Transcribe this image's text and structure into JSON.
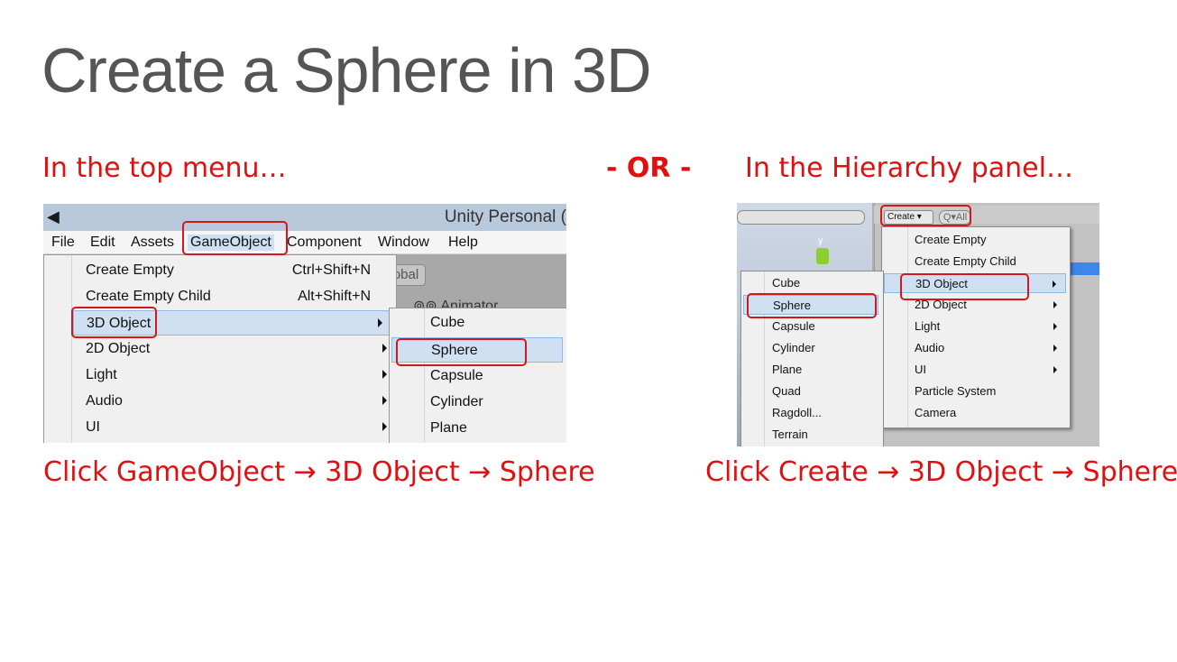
{
  "slide": {
    "title": "Create a Sphere in 3D",
    "left_heading": "In the top menu…",
    "or_text": "- OR -",
    "right_heading": "In the Hierarchy panel…",
    "left_caption": "Click GameObject → 3D Object → Sphere",
    "right_caption": "Click Create → 3D Object → Sphere"
  },
  "left_shot": {
    "window_title": "Unity Personal (",
    "menubar": [
      "File",
      "Edit",
      "Assets",
      "GameObject",
      "Component",
      "Window",
      "Help"
    ],
    "background_button": "obal",
    "background_label": "⊚⊚ Animator",
    "menu": [
      {
        "label": "Create Empty",
        "shortcut": "Ctrl+Shift+N"
      },
      {
        "label": "Create Empty Child",
        "shortcut": "Alt+Shift+N"
      },
      {
        "label": "3D Object",
        "shortcut": ""
      },
      {
        "label": "2D Object",
        "shortcut": ""
      },
      {
        "label": "Light",
        "shortcut": ""
      },
      {
        "label": "Audio",
        "shortcut": ""
      },
      {
        "label": "UI",
        "shortcut": ""
      }
    ],
    "submenu": [
      "Cube",
      "Sphere",
      "Capsule",
      "Cylinder",
      "Plane"
    ]
  },
  "right_shot": {
    "create_button": "Create ▾",
    "search_placeholder": "Q▾All",
    "gizmo_axis": "y",
    "menu": [
      "Create Empty",
      "Create Empty Child",
      "3D Object",
      "2D Object",
      "Light",
      "Audio",
      "UI",
      "Particle System",
      "Camera"
    ],
    "submenu": [
      "Cube",
      "Sphere",
      "Capsule",
      "Cylinder",
      "Plane",
      "Quad",
      "Ragdoll...",
      "Terrain"
    ]
  },
  "colors": {
    "accent_red": "#e01010",
    "title_gray": "#555555",
    "highlight": "#cfe0f2",
    "callout_box": "#d21818"
  }
}
